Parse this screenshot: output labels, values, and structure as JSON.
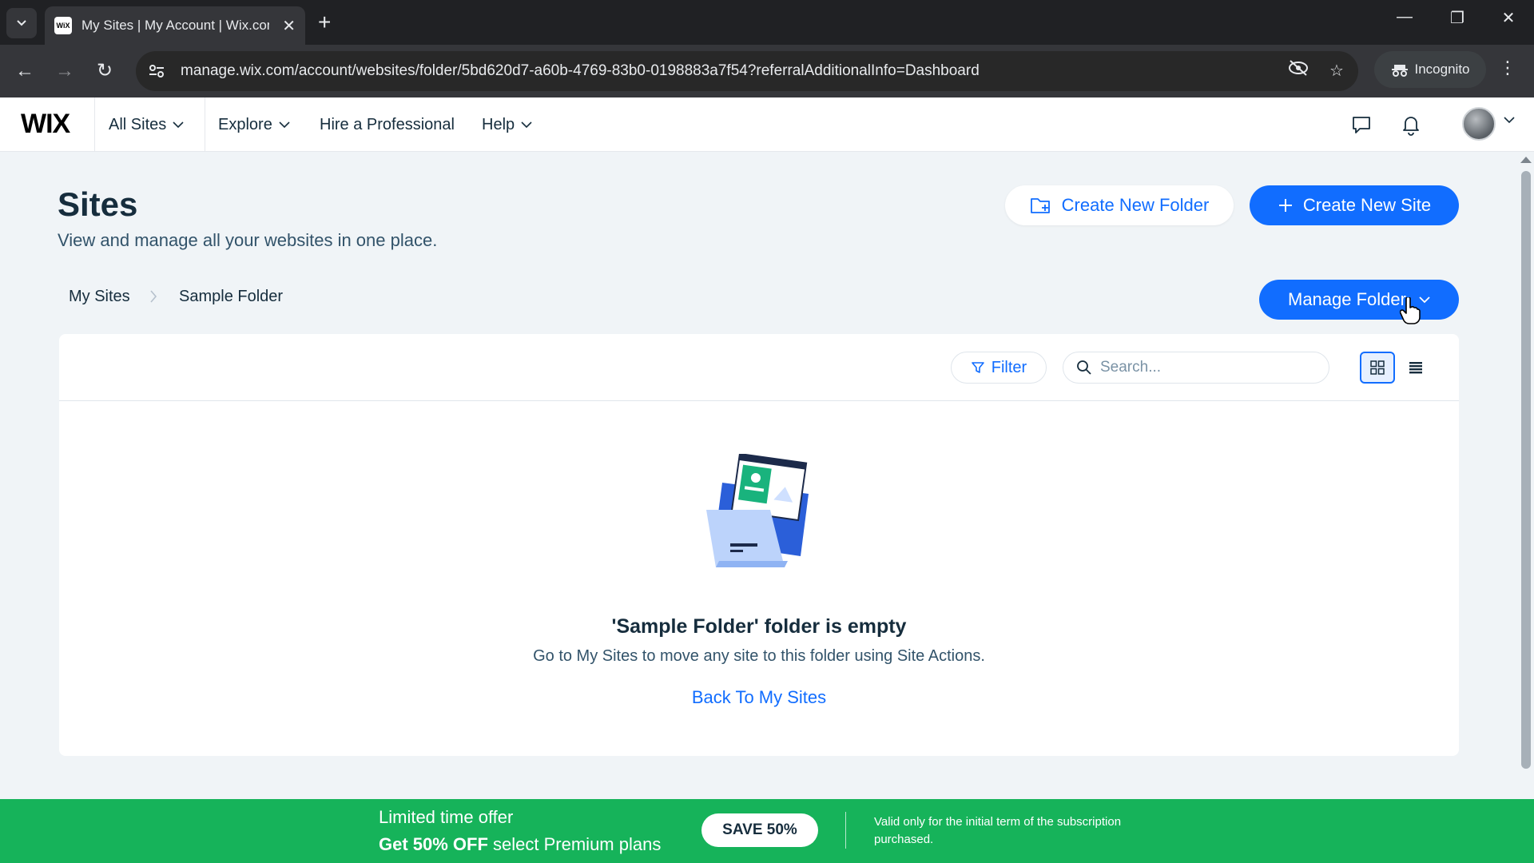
{
  "browser": {
    "tab_title": "My Sites | My Account | Wix.com",
    "favicon_text": "WiX",
    "url": "manage.wix.com/account/websites/folder/5bd620d7-a60b-4769-83b0-0198883a7f54?referralAdditionalInfo=Dashboard",
    "incognito_label": "Incognito"
  },
  "header": {
    "logo": "WIX",
    "menu": [
      {
        "label": "All Sites"
      },
      {
        "label": "Explore"
      },
      {
        "label": "Hire a Professional"
      },
      {
        "label": "Help"
      }
    ]
  },
  "page": {
    "title": "Sites",
    "subtitle": "View and manage all your websites in one place.",
    "create_folder_label": "Create New Folder",
    "create_site_label": "Create New Site",
    "breadcrumb": [
      "My Sites",
      "Sample Folder"
    ],
    "manage_folder_label": "Manage Folder"
  },
  "toolbar": {
    "filter_label": "Filter",
    "search_placeholder": "Search..."
  },
  "empty_state": {
    "title": "'Sample Folder' folder is empty",
    "text": "Go to My Sites to move any site to this folder using Site Actions.",
    "link": "Back To My Sites"
  },
  "promo": {
    "line1": "Limited time offer",
    "line2_bold": "Get 50% OFF",
    "line2_rest": " select Premium plans",
    "button": "SAVE 50%",
    "note": "Valid only for the initial term of the subscription purchased."
  },
  "colors": {
    "accent": "#116dff",
    "promo_green": "#16b35a",
    "text_dark": "#162d3d"
  }
}
